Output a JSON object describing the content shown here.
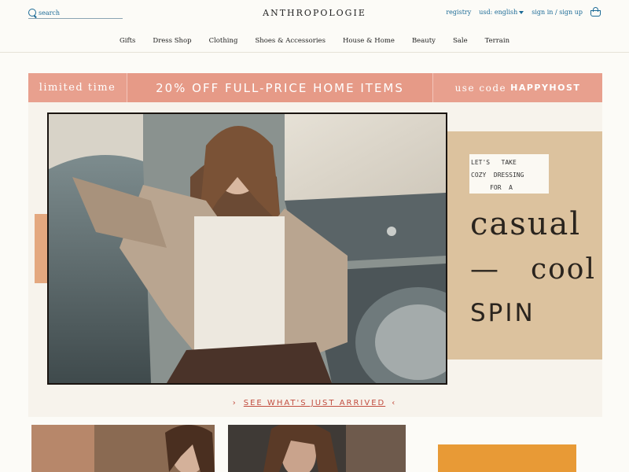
{
  "header": {
    "search_placeholder": "search",
    "logo": "ANTHROPOLOGIE",
    "registry": "registry",
    "currency": "usd: english",
    "account": "sign in / sign up"
  },
  "nav": [
    "Gifts",
    "Dress Shop",
    "Clothing",
    "Shoes & Accessories",
    "House & Home",
    "Beauty",
    "Sale",
    "Terrain"
  ],
  "promo": {
    "left": "limited time",
    "middle": "20% OFF FULL-PRICE HOME ITEMS",
    "right_prefix": "use code",
    "code": "HAPPYHOST"
  },
  "hero": {
    "note": "LET'S   TAKE\nCOZY  DRESSING\n     FOR  A",
    "line1": "casual",
    "line2_dash": "—",
    "line2_word": "cool",
    "line3": "SPIN",
    "cta_left": "›",
    "cta": "SEE WHAT'S JUST ARRIVED",
    "cta_right": "‹"
  },
  "colors": {
    "promo": "#e8a08e",
    "link": "#1b6a96",
    "cta": "#c24d3f",
    "panel": "#dcc29e"
  }
}
